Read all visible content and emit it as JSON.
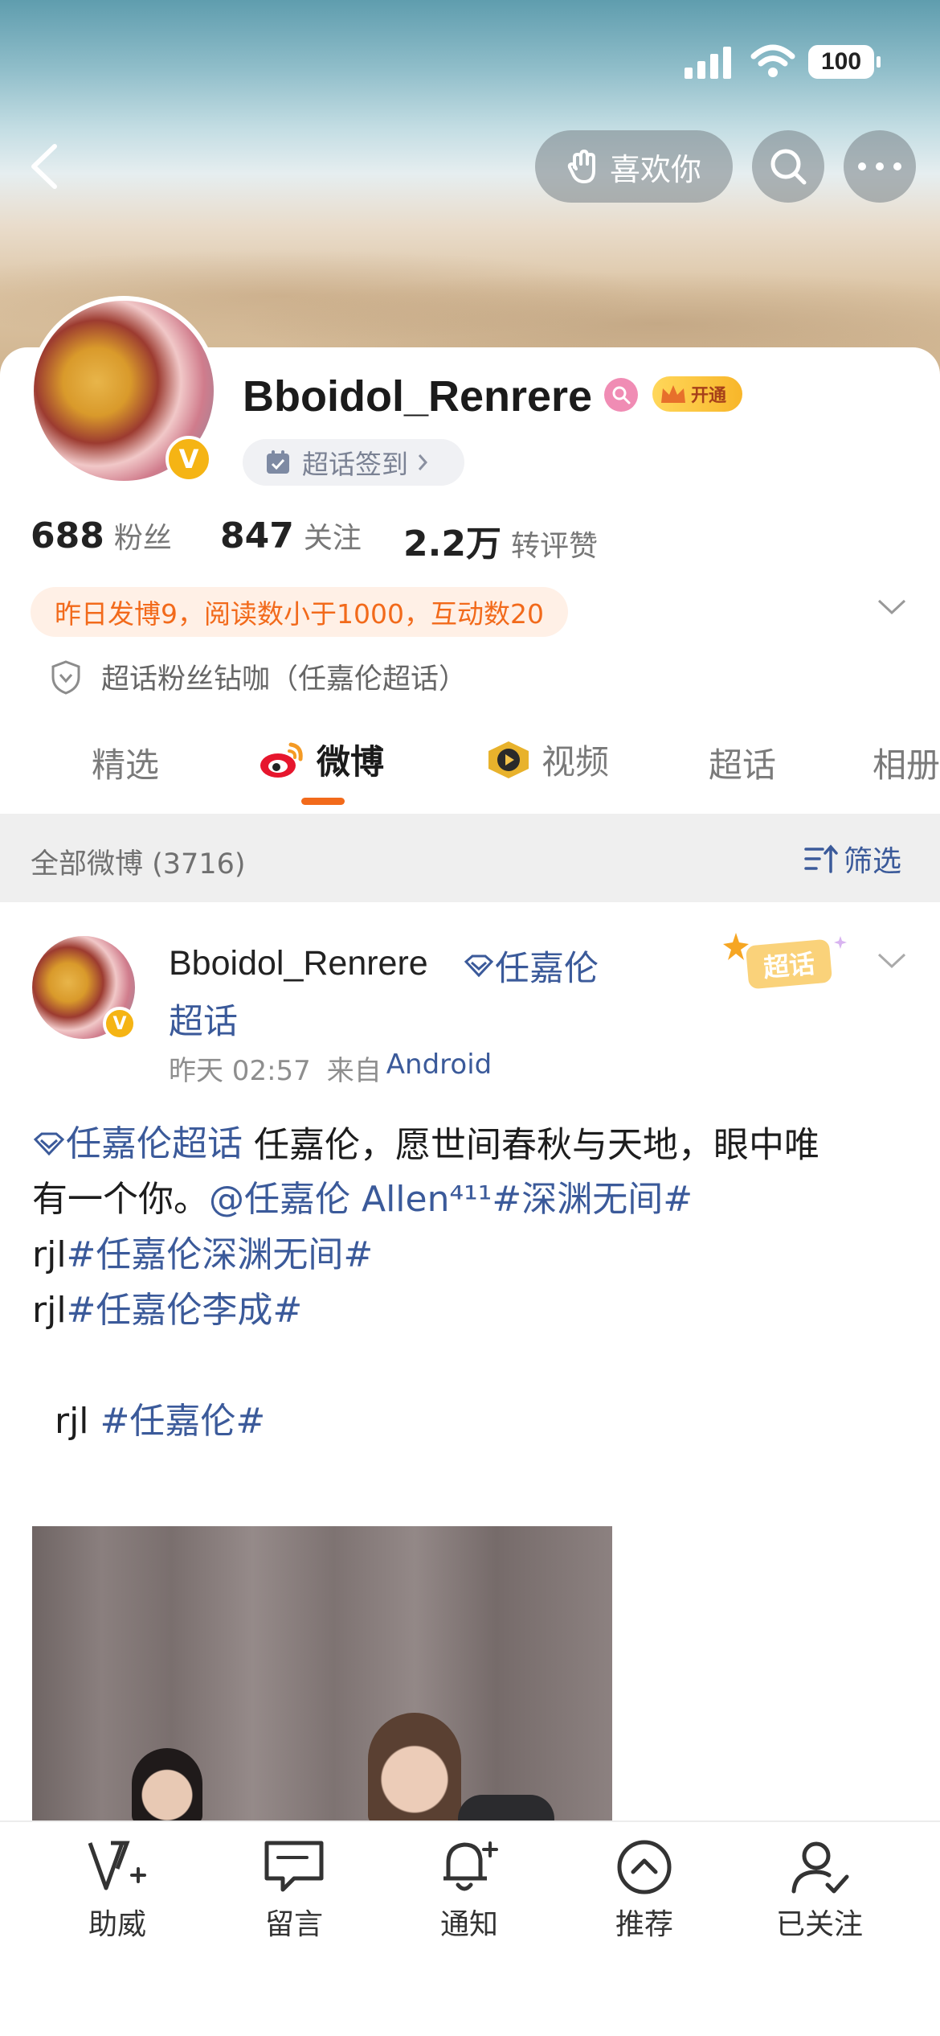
{
  "status_bar": {
    "battery": "100"
  },
  "header": {
    "like_button_label": "喜欢你"
  },
  "profile": {
    "username": "Bboidol_Renrere",
    "member_badge_label": "开通",
    "supertopic_checkin_label": "超话签到",
    "stats": [
      {
        "value": "688",
        "label": "粉丝"
      },
      {
        "value": "847",
        "label": "关注"
      },
      {
        "value": "2.2万",
        "label": "转评赞"
      }
    ],
    "activity_summary": "昨日发博9，阅读数小于1000，互动数20",
    "fan_title": "超话粉丝钻咖（任嘉伦超话）"
  },
  "tabs": [
    {
      "label": "精选"
    },
    {
      "label": "微博",
      "active": true
    },
    {
      "label": "视频"
    },
    {
      "label": "超话"
    },
    {
      "label": "相册"
    }
  ],
  "filter_bar": {
    "all_posts_label": "全部微博 (3716)",
    "filter_label": "筛选"
  },
  "post": {
    "author": "Bboidol_Renrere",
    "supertopic_tag": "任嘉伦",
    "supertopic_tag_line2": "超话",
    "sticker_label": "超话",
    "time": "昨天 02:57",
    "source_prefix": "来自",
    "source": "Android",
    "line1_topic": "任嘉伦超话",
    "line1_text": " 任嘉伦，愿世间春秋与天地，眼中唯",
    "line2_text": "有一个你。",
    "line2_mention": "@任嘉伦 Allen⁴¹¹",
    "line2_hashtag": "#深渊无间#",
    "line3_prefix": "rjl",
    "line3_hashtag": "#任嘉伦深渊无间#",
    "line4_prefix": "rjl",
    "line4_hashtag": "#任嘉伦李成#",
    "line5_prefix": "rjl ",
    "line5_hashtag": "#任嘉伦#"
  },
  "bottom_nav": [
    {
      "label": "助威",
      "icon": "cheer-v-icon"
    },
    {
      "label": "留言",
      "icon": "message-icon"
    },
    {
      "label": "通知",
      "icon": "bell-plus-icon"
    },
    {
      "label": "推荐",
      "icon": "recommend-up-icon"
    },
    {
      "label": "已关注",
      "icon": "user-check-icon"
    }
  ],
  "colors": {
    "accent_orange": "#f26a1b",
    "link_blue": "#3b5a9a",
    "vip_gold": "#f5b414"
  }
}
